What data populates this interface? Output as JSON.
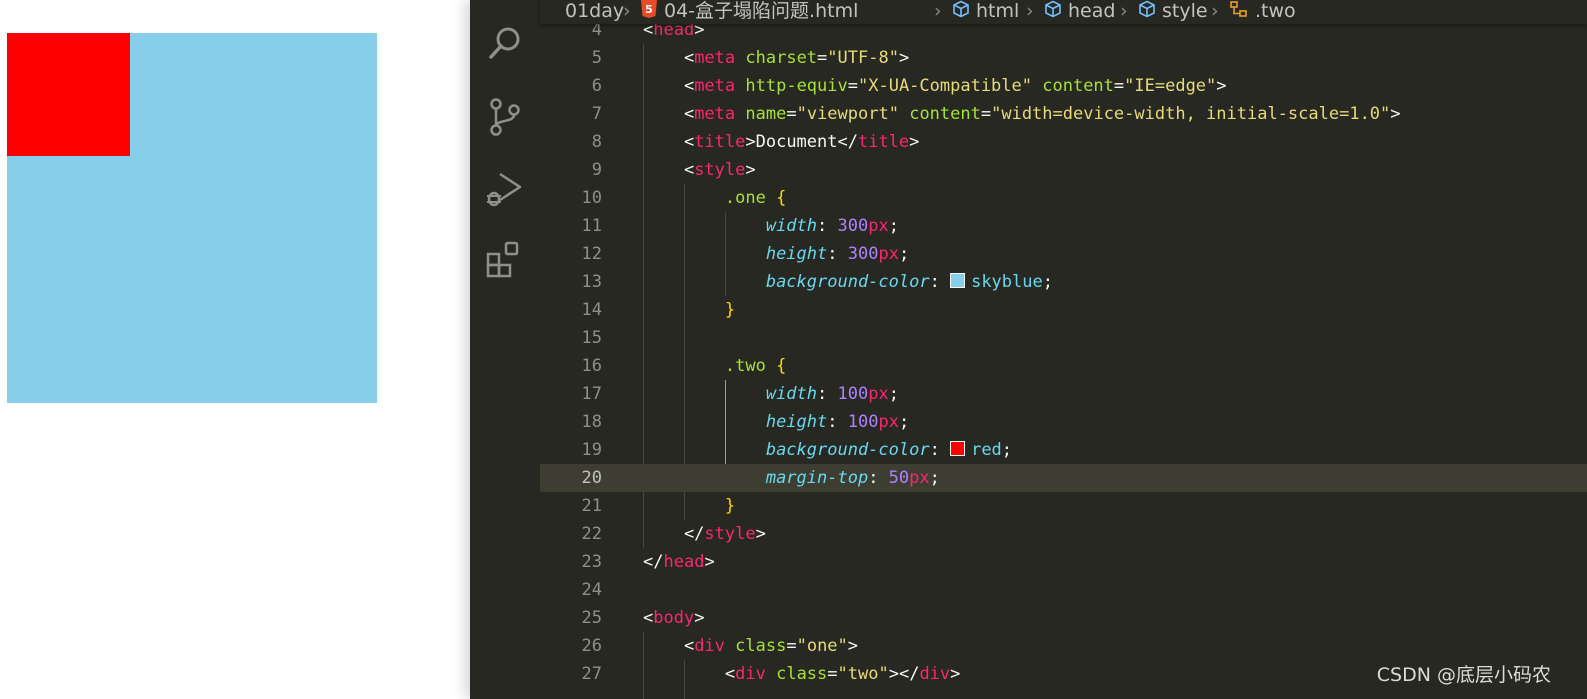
{
  "preview": {
    "one": {
      "color": "#87ceeb"
    },
    "two": {
      "color": "#ff0000"
    }
  },
  "activitybar": {
    "icons": [
      "search-icon",
      "source-control-icon",
      "run-debug-icon",
      "extensions-icon"
    ]
  },
  "breadcrumb": {
    "folder": "01day",
    "file": "04-盒子塌陷问题.html",
    "html": "html",
    "head": "head",
    "style": "style",
    "selector": ".two"
  },
  "code": {
    "current_line": 20,
    "lines": [
      {
        "n": "4",
        "tokens": [
          [
            "p",
            "<"
          ],
          [
            "tag",
            "head"
          ],
          [
            "p",
            ">"
          ]
        ]
      },
      {
        "n": "5",
        "tokens": [
          [
            "p",
            "    <"
          ],
          [
            "tag",
            "meta"
          ],
          [
            "p",
            " "
          ],
          [
            "attr",
            "charset"
          ],
          [
            "p",
            "="
          ],
          [
            "str",
            "\"UTF-8\""
          ],
          [
            "p",
            ">"
          ]
        ]
      },
      {
        "n": "6",
        "tokens": [
          [
            "p",
            "    <"
          ],
          [
            "tag",
            "meta"
          ],
          [
            "p",
            " "
          ],
          [
            "attr",
            "http-equiv"
          ],
          [
            "p",
            "="
          ],
          [
            "str",
            "\"X-UA-Compatible\""
          ],
          [
            "p",
            " "
          ],
          [
            "attr",
            "content"
          ],
          [
            "p",
            "="
          ],
          [
            "str",
            "\"IE=edge\""
          ],
          [
            "p",
            ">"
          ]
        ]
      },
      {
        "n": "7",
        "tokens": [
          [
            "p",
            "    <"
          ],
          [
            "tag",
            "meta"
          ],
          [
            "p",
            " "
          ],
          [
            "attr",
            "name"
          ],
          [
            "p",
            "="
          ],
          [
            "str",
            "\"viewport\""
          ],
          [
            "p",
            " "
          ],
          [
            "attr",
            "content"
          ],
          [
            "p",
            "="
          ],
          [
            "str",
            "\"width=device-width, initial-scale=1.0\""
          ],
          [
            "p",
            ">"
          ]
        ]
      },
      {
        "n": "8",
        "tokens": [
          [
            "p",
            "    <"
          ],
          [
            "tag",
            "title"
          ],
          [
            "p",
            ">Document</"
          ],
          [
            "tag",
            "title"
          ],
          [
            "p",
            ">"
          ]
        ]
      },
      {
        "n": "9",
        "tokens": [
          [
            "p",
            "    <"
          ],
          [
            "tag",
            "style"
          ],
          [
            "p",
            ">"
          ]
        ]
      },
      {
        "n": "10",
        "tokens": [
          [
            "p",
            "        "
          ],
          [
            "sel",
            ".one"
          ],
          [
            "p",
            " "
          ],
          [
            "brace",
            "{"
          ]
        ]
      },
      {
        "n": "11",
        "tokens": [
          [
            "p",
            "            "
          ],
          [
            "prop",
            "width"
          ],
          [
            "p",
            ": "
          ],
          [
            "num",
            "300"
          ],
          [
            "unit",
            "px"
          ],
          [
            "p",
            ";"
          ]
        ]
      },
      {
        "n": "12",
        "tokens": [
          [
            "p",
            "            "
          ],
          [
            "prop",
            "height"
          ],
          [
            "p",
            ": "
          ],
          [
            "num",
            "300"
          ],
          [
            "unit",
            "px"
          ],
          [
            "p",
            ";"
          ]
        ]
      },
      {
        "n": "13",
        "tokens": [
          [
            "p",
            "            "
          ],
          [
            "prop",
            "background-color"
          ],
          [
            "p",
            ": "
          ],
          [
            "swatch",
            "#87ceeb"
          ],
          [
            "val",
            "skyblue"
          ],
          [
            "p",
            ";"
          ]
        ]
      },
      {
        "n": "14",
        "tokens": [
          [
            "p",
            "        "
          ],
          [
            "brace",
            "}"
          ]
        ]
      },
      {
        "n": "15",
        "tokens": []
      },
      {
        "n": "16",
        "tokens": [
          [
            "p",
            "        "
          ],
          [
            "sel",
            ".two"
          ],
          [
            "p",
            " "
          ],
          [
            "brace",
            "{"
          ]
        ]
      },
      {
        "n": "17",
        "tokens": [
          [
            "p",
            "            "
          ],
          [
            "prop",
            "width"
          ],
          [
            "p",
            ": "
          ],
          [
            "num",
            "100"
          ],
          [
            "unit",
            "px"
          ],
          [
            "p",
            ";"
          ]
        ]
      },
      {
        "n": "18",
        "tokens": [
          [
            "p",
            "            "
          ],
          [
            "prop",
            "height"
          ],
          [
            "p",
            ": "
          ],
          [
            "num",
            "100"
          ],
          [
            "unit",
            "px"
          ],
          [
            "p",
            ";"
          ]
        ]
      },
      {
        "n": "19",
        "tokens": [
          [
            "p",
            "            "
          ],
          [
            "prop",
            "background-color"
          ],
          [
            "p",
            ": "
          ],
          [
            "swatch",
            "#ff0000"
          ],
          [
            "val",
            "red"
          ],
          [
            "p",
            ";"
          ]
        ]
      },
      {
        "n": "20",
        "tokens": [
          [
            "p",
            "            "
          ],
          [
            "prop",
            "margin-top"
          ],
          [
            "p",
            ": "
          ],
          [
            "num",
            "50"
          ],
          [
            "unit",
            "px"
          ],
          [
            "p",
            ";"
          ]
        ]
      },
      {
        "n": "21",
        "tokens": [
          [
            "p",
            "        "
          ],
          [
            "brace",
            "}"
          ]
        ]
      },
      {
        "n": "22",
        "tokens": [
          [
            "p",
            "    </"
          ],
          [
            "tag",
            "style"
          ],
          [
            "p",
            ">"
          ]
        ]
      },
      {
        "n": "23",
        "tokens": [
          [
            "p",
            "</"
          ],
          [
            "tag",
            "head"
          ],
          [
            "p",
            ">"
          ]
        ]
      },
      {
        "n": "24",
        "tokens": []
      },
      {
        "n": "25",
        "tokens": [
          [
            "p",
            "<"
          ],
          [
            "tag",
            "body"
          ],
          [
            "p",
            ">"
          ]
        ]
      },
      {
        "n": "26",
        "tokens": [
          [
            "p",
            "    <"
          ],
          [
            "tag",
            "div"
          ],
          [
            "p",
            " "
          ],
          [
            "attr",
            "class"
          ],
          [
            "p",
            "="
          ],
          [
            "str",
            "\"one\""
          ],
          [
            "p",
            ">"
          ]
        ]
      },
      {
        "n": "27",
        "tokens": [
          [
            "p",
            "        <"
          ],
          [
            "tag",
            "div"
          ],
          [
            "p",
            " "
          ],
          [
            "attr",
            "class"
          ],
          [
            "p",
            "="
          ],
          [
            "str",
            "\"two\""
          ],
          [
            "p",
            "></"
          ],
          [
            "tag",
            "div"
          ],
          [
            "p",
            ">"
          ]
        ]
      }
    ]
  },
  "watermark": "CSDN @底层小码农"
}
